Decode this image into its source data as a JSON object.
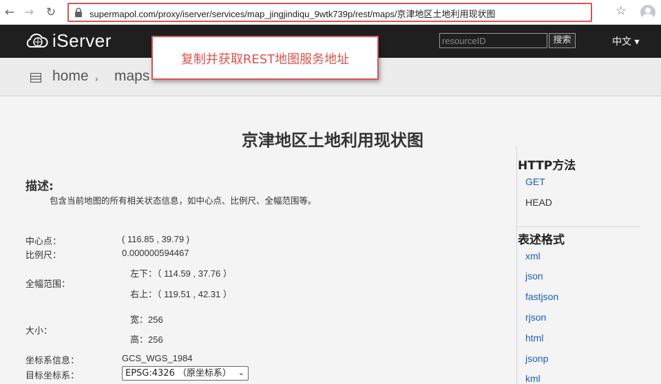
{
  "browser": {
    "back_icon": "arrow-left-icon",
    "forward_icon": "arrow-right-icon",
    "reload_icon": "reload-icon",
    "url": "supermapol.com/proxy/iserver/services/map_jingjindiqu_9wtk739p/rest/maps/京津地区土地利用现状图",
    "lock_icon": "lock-icon",
    "star_icon": "star-icon",
    "profile_icon": "avatar-icon"
  },
  "header": {
    "logo_text": "iServer",
    "logo_icon": "cloud-globe-icon",
    "search_placeholder": "resourceID",
    "search_button": "搜索",
    "language": "中文 ▾",
    "accent": "#d9534f"
  },
  "breadcrumb": {
    "icon": "list-icon",
    "home": "home",
    "sep": "›",
    "maps": "maps"
  },
  "callout": {
    "text": "复制并获取REST地图服务地址"
  },
  "page": {
    "title": "京津地区土地利用现状图",
    "desc_heading": "描述:",
    "desc_text": "包含当前地图的所有相关状态信息，如中心点、比例尺、全幅范围等。"
  },
  "props": {
    "center_label": "中心点：",
    "center_value": "( 116.85 , 39.79 )",
    "scale_label": "比例尺：",
    "scale_value": "0.000000594467",
    "bounds_label": "全幅范围：",
    "bounds_lower": "左下：（ 114.59 , 37.76 ）",
    "bounds_upper": "右上：（ 119.51 , 42.31 ）",
    "size_label": "大小：",
    "size_width": "宽：256",
    "size_height": "高：256",
    "crs_label": "坐标系信息：",
    "crs_value": "GCS_WGS_1984",
    "target_crs_label": "目标坐标系：",
    "target_crs_selected": "EPSG:4326 （原坐标系）"
  },
  "sidebar": {
    "http_heading": "HTTP方法",
    "methods": [
      "GET",
      "HEAD"
    ],
    "format_heading": "表述格式",
    "formats": [
      "xml",
      "json",
      "fastjson",
      "rjson",
      "html",
      "jsonp",
      "kml"
    ]
  }
}
